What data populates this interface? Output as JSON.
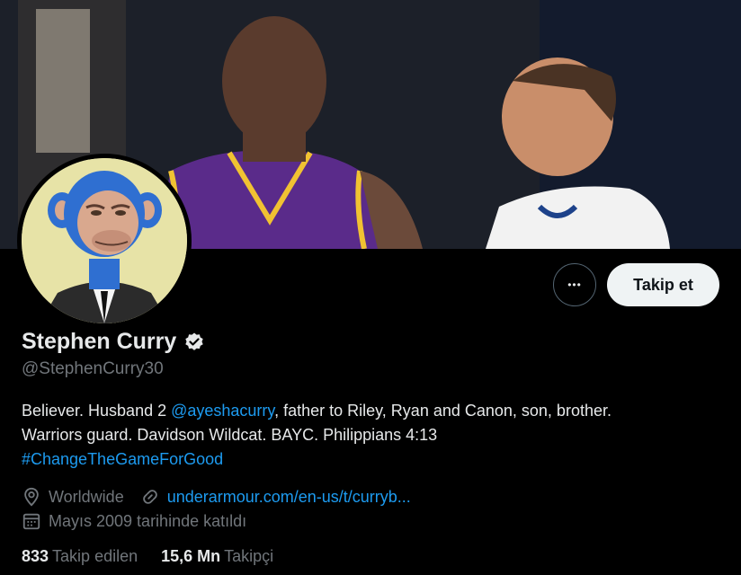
{
  "profile": {
    "name": "Stephen Curry",
    "handle": "@StephenCurry30",
    "bio": {
      "line1_pre": "Believer. Husband 2 ",
      "line1_mention": "@ayeshacurry",
      "line1_post": ", father to Riley, Ryan and Canon, son, brother.",
      "line2": "Warriors guard. Davidson Wildcat. BAYC. Philippians 4:13",
      "line3_hashtag": "#ChangeTheGameForGood"
    },
    "location": "Worldwide",
    "website": "underarmour.com/en-us/t/curryb...",
    "joined": "Mayıs 2009 tarihinde katıldı"
  },
  "actions": {
    "more_label": "•••",
    "follow_label": "Takip et"
  },
  "stats": {
    "following_count": "833",
    "following_label": "Takip edilen",
    "followers_count": "15,6 Mn",
    "followers_label": "Takipçi"
  },
  "icons": {
    "verified": "verified-badge-icon",
    "location": "location-pin-icon",
    "website": "link-icon",
    "joined": "calendar-icon",
    "more": "more-dots-icon"
  },
  "colors": {
    "background": "#000000",
    "link": "#1d9bf0",
    "secondary_text": "#71767b",
    "follow_button_bg": "#eff3f4",
    "avatar_bg": "#e7e3a7"
  }
}
